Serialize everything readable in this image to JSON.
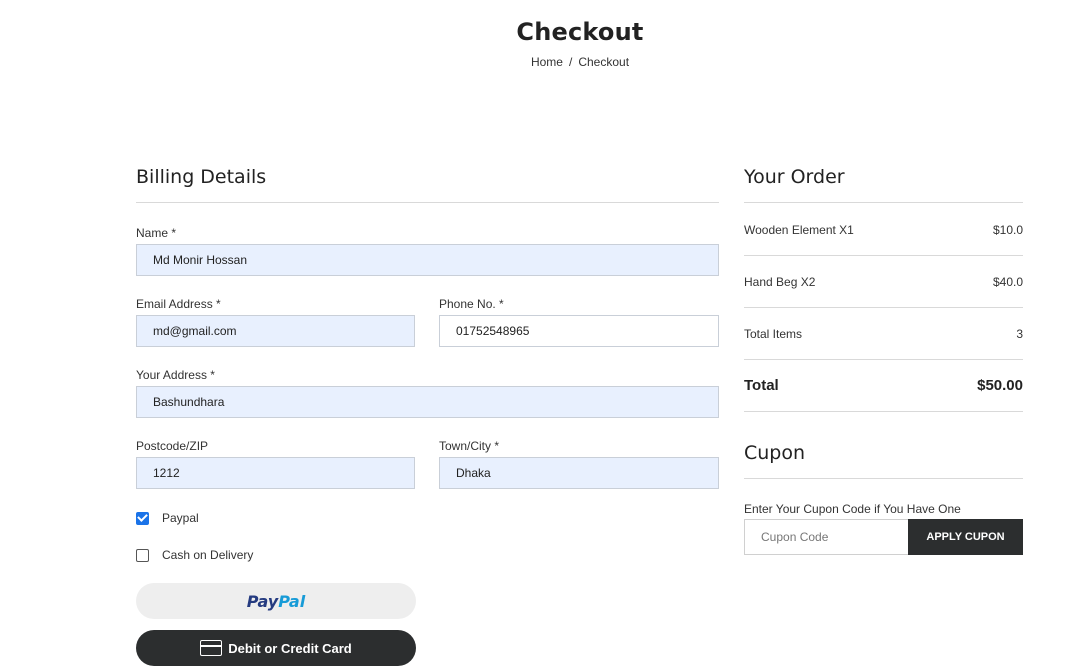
{
  "header": {
    "title": "Checkout",
    "breadcrumb": {
      "home": "Home",
      "separator": "/",
      "current": "Checkout"
    }
  },
  "billing": {
    "title": "Billing Details",
    "name": {
      "label": "Name *",
      "value": "Md Monir Hossan"
    },
    "email": {
      "label": "Email Address *",
      "value": "md@gmail.com"
    },
    "phone": {
      "label": "Phone No. *",
      "value": "01752548965"
    },
    "address": {
      "label": "Your Address *",
      "value": "Bashundhara"
    },
    "postcode": {
      "label": "Postcode/ZIP",
      "value": "1212"
    },
    "town": {
      "label": "Town/City *",
      "value": "Dhaka"
    },
    "payment_options": [
      {
        "label": "Paypal",
        "checked": true
      },
      {
        "label": "Cash on Delivery",
        "checked": false
      }
    ],
    "paypal_button": {
      "part1": "Pay",
      "part2": "Pal"
    },
    "card_button": {
      "label": "Debit or Credit Card"
    }
  },
  "order": {
    "title": "Your Order",
    "items": [
      {
        "name": "Wooden Element X1",
        "price": "$10.0"
      },
      {
        "name": "Hand Beg X2",
        "price": "$40.0"
      },
      {
        "name": "Total Items",
        "price": "3"
      }
    ],
    "total": {
      "label": "Total",
      "value": "$50.00"
    }
  },
  "cupon": {
    "title": "Cupon",
    "label": "Enter Your Cupon Code if You Have One",
    "placeholder": "Cupon Code",
    "button": "APPLY CUPON"
  },
  "colors": {
    "accent": "#1a73e8",
    "dark_button": "#2c2e2f",
    "autofill_bg": "#e8f0fe",
    "paypal_dark": "#253b80",
    "paypal_light": "#179bd7"
  }
}
